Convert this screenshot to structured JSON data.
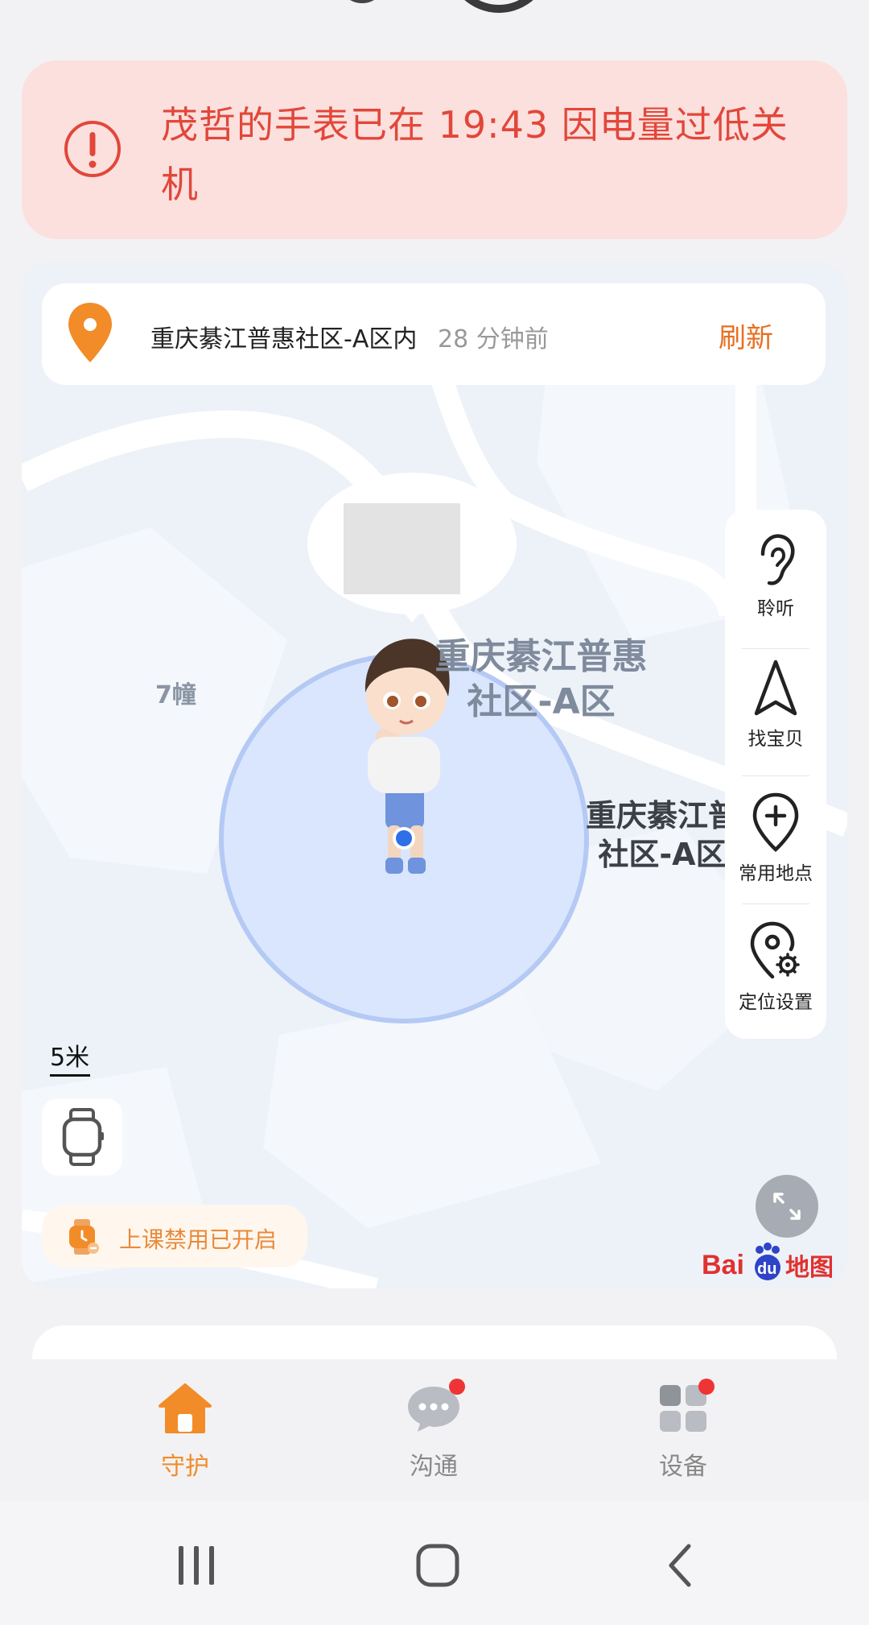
{
  "alert": {
    "message": "茂哲的手表已在 19:43 因电量过低关机"
  },
  "location": {
    "place": "重庆綦江普惠社区-A区内",
    "time_ago": "28 分钟前",
    "refresh_label": "刷新"
  },
  "map": {
    "label_main": "重庆綦江普惠\n社区-A区",
    "label_secondary": "重庆綦江普\n社区-A区",
    "label_building": "7幢",
    "scale": "5米",
    "provider": "Bai du 地图"
  },
  "side_tools": [
    {
      "label": "聆听",
      "icon": "ear-icon"
    },
    {
      "label": "找宝贝",
      "icon": "navigation-arrow-icon"
    },
    {
      "label": "常用地点",
      "icon": "location-plus-icon"
    },
    {
      "label": "定位设置",
      "icon": "location-settings-icon"
    }
  ],
  "class_mode": {
    "label": "上课禁用已开启"
  },
  "tabs": [
    {
      "label": "守护",
      "icon": "home-icon",
      "active": true,
      "badge": false
    },
    {
      "label": "沟通",
      "icon": "chat-icon",
      "active": false,
      "badge": true
    },
    {
      "label": "设备",
      "icon": "grid-icon",
      "active": false,
      "badge": true
    }
  ],
  "colors": {
    "accent": "#F28C28",
    "alert_text": "#E2473A",
    "alert_bg": "#FBE0DE",
    "badge": "#EE3434"
  }
}
